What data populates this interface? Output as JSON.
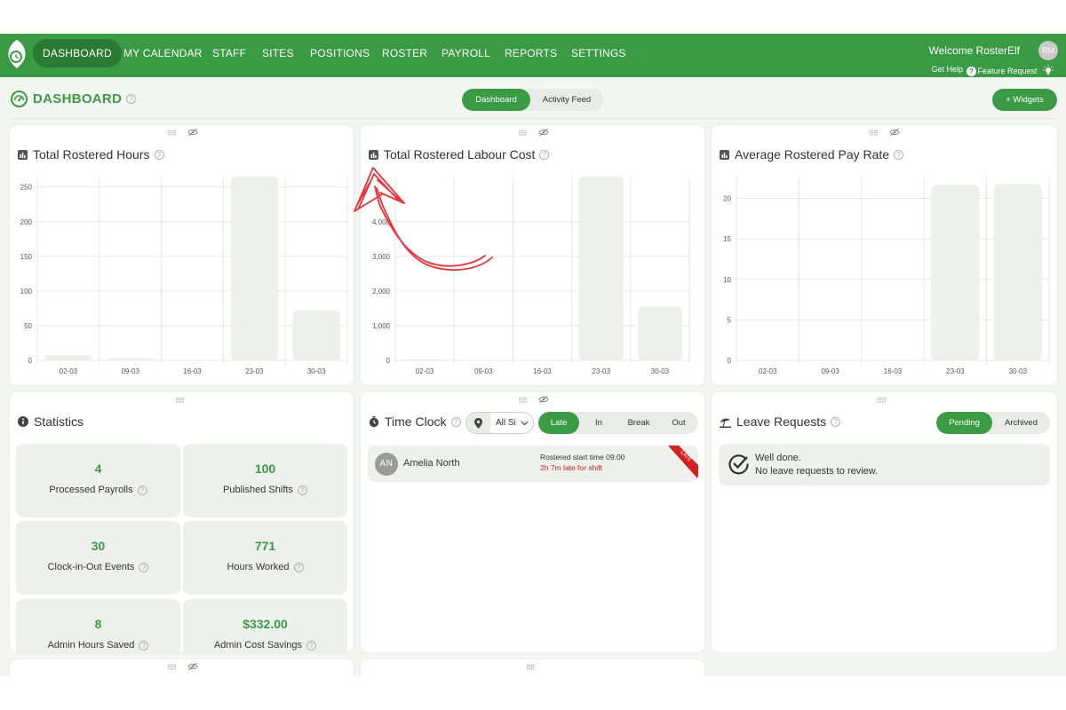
{
  "nav": {
    "items": [
      "DASHBOARD",
      "MY CALENDAR",
      "STAFF",
      "SITES",
      "POSITIONS",
      "ROSTER",
      "PAYROLL",
      "REPORTS",
      "SETTINGS"
    ],
    "active": "DASHBOARD",
    "welcome": "Welcome RosterElf",
    "avatar_initials": "RM",
    "get_help": "Get Help",
    "feature_request": "Feature Request"
  },
  "page": {
    "title": "DASHBOARD",
    "view_tabs": [
      "Dashboard",
      "Activity Feed"
    ],
    "active_view": "Dashboard",
    "widgets_button": "+ Widgets"
  },
  "widgets": {
    "hours": {
      "title": "Total Rostered Hours"
    },
    "cost": {
      "title": "Total Rostered Labour Cost"
    },
    "rate": {
      "title": "Average Rostered Pay Rate"
    },
    "statistics": {
      "title": "Statistics",
      "items": [
        {
          "value": "4",
          "label": "Processed Payrolls"
        },
        {
          "value": "100",
          "label": "Published Shifts"
        },
        {
          "value": "30",
          "label": "Clock-in-Out Events"
        },
        {
          "value": "771",
          "label": "Hours Worked"
        },
        {
          "value": "8",
          "label": "Admin Hours Saved"
        },
        {
          "value": "$332.00",
          "label": "Admin Cost Savings"
        }
      ]
    },
    "time_clock": {
      "title": "Time Clock",
      "site_value": "All Si",
      "tabs": [
        "Late",
        "In",
        "Break",
        "Out"
      ],
      "active_tab": "Late",
      "entry": {
        "initials": "AN",
        "name": "Amelia North",
        "rostered_start": "Rostered start time 09:00",
        "late_text": "2h 7m late for shift",
        "badge": "LATE"
      }
    },
    "leave": {
      "title": "Leave Requests",
      "tabs": [
        "Pending",
        "Archived"
      ],
      "active_tab": "Pending",
      "message_line1": "Well done.",
      "message_line2": "No leave requests to review."
    }
  },
  "colors": {
    "brand_green": "#3a9b44",
    "nav_active": "#2b7a33",
    "bar_fill": "#eef0ee",
    "late_red": "#d32020"
  },
  "chart_data": [
    {
      "type": "bar",
      "title": "Total Rostered Hours",
      "categories": [
        "02-03",
        "09-03",
        "16-03",
        "23-03",
        "30-03"
      ],
      "values": [
        8,
        3,
        0,
        265,
        72
      ],
      "ylim": [
        0,
        250
      ],
      "yticks": [
        "0",
        "50",
        "100",
        "150",
        "200",
        "250"
      ],
      "grid": true
    },
    {
      "type": "bar",
      "title": "Total Rostered Labour Cost",
      "categories": [
        "02-03",
        "09-03",
        "16-03",
        "23-03",
        "30-03"
      ],
      "values": [
        30,
        15,
        0,
        5300,
        1550
      ],
      "ylim": [
        0,
        5000
      ],
      "yticks": [
        "0",
        "1,000",
        "2,000",
        "3,000",
        "4,000"
      ],
      "grid": true
    },
    {
      "type": "bar",
      "title": "Average Rostered Pay Rate",
      "categories": [
        "02-03",
        "09-03",
        "16-03",
        "23-03",
        "30-03"
      ],
      "values": [
        0,
        0,
        0,
        21.7,
        21.8
      ],
      "ylim": [
        0,
        22
      ],
      "yticks": [
        "0",
        "5",
        "10",
        "15",
        "20"
      ],
      "grid": true
    }
  ]
}
